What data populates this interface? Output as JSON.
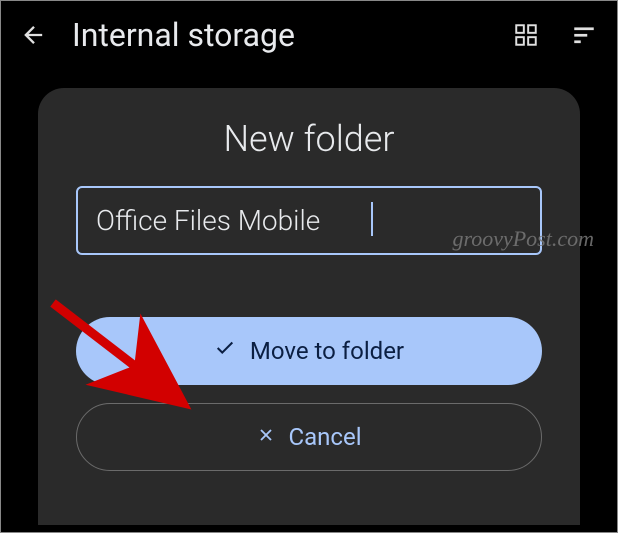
{
  "header": {
    "title": "Internal storage"
  },
  "dialog": {
    "title": "New folder",
    "input_value": "Office Files Mobile",
    "primary_label": "Move to folder",
    "cancel_label": "Cancel"
  },
  "watermark": "groovyPost.com",
  "icons": {
    "back": "back-arrow-icon",
    "grid": "grid-view-icon",
    "sort": "sort-icon",
    "check": "check-icon",
    "close": "close-x-icon"
  }
}
